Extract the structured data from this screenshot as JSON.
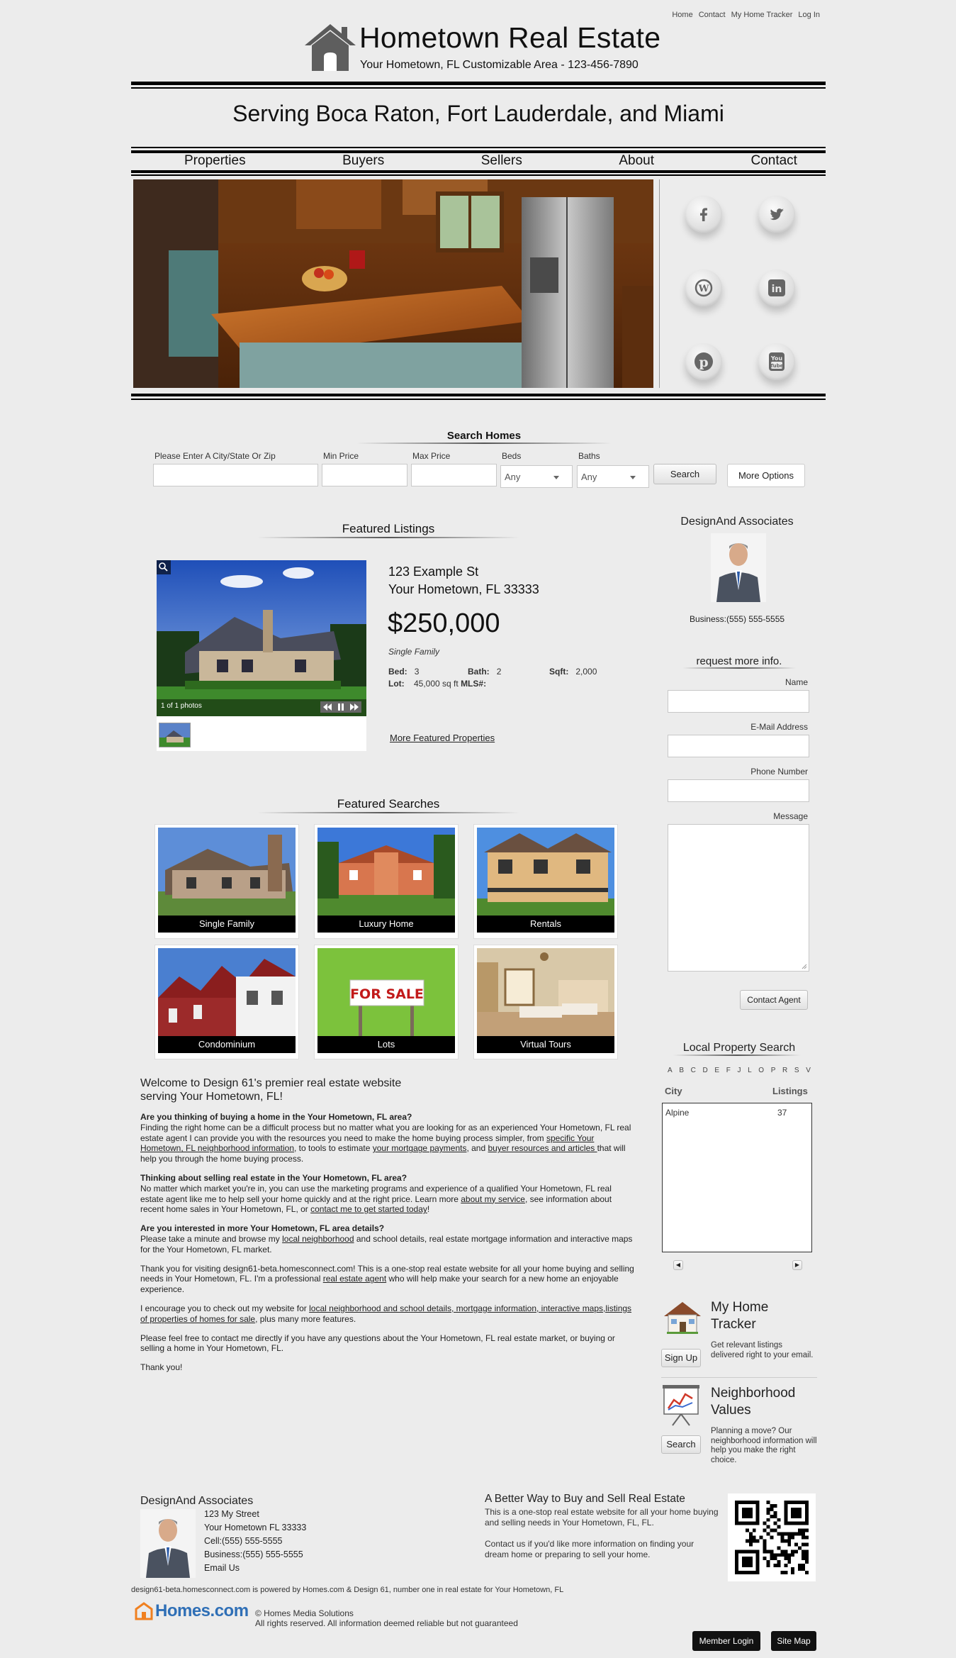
{
  "top_links": [
    "Home",
    "Contact",
    "My Home Tracker",
    "Log In"
  ],
  "header": {
    "title": "Hometown Real Estate",
    "subtitle": "Your Hometown, FL Customizable Area - 123-456-7890",
    "tagline": "Serving Boca Raton, Fort Lauderdale, and Miami"
  },
  "nav": [
    "Properties",
    "Buyers",
    "Sellers",
    "About",
    "Contact"
  ],
  "social_icons": [
    "facebook-icon",
    "twitter-icon",
    "wordpress-icon",
    "linkedin-icon",
    "pinterest-icon",
    "youtube-icon"
  ],
  "search": {
    "title": "Search Homes",
    "city_label": "Please Enter A City/State Or Zip",
    "min_label": "Min Price",
    "max_label": "Max Price",
    "beds_label": "Beds",
    "baths_label": "Baths",
    "beds_value": "Any",
    "baths_value": "Any",
    "search_button": "Search",
    "more_button": "More Options"
  },
  "featured": {
    "title": "Featured Listings",
    "address_line1": "123 Example St",
    "address_line2": "Your Hometown, FL 33333",
    "price": "$250,000",
    "type": "Single Family",
    "bed_label": "Bed:",
    "bed": "3",
    "bath_label": "Bath:",
    "bath": "2",
    "sqft_label": "Sqft:",
    "sqft": "2,000",
    "lot_label": "Lot:",
    "lot": "45,000 sq ft",
    "mls_label": "MLS#:",
    "photo_count": "1 of 1 photos",
    "more_link": "More Featured Properties"
  },
  "featured_searches": {
    "title": "Featured Searches",
    "tiles": [
      "Single Family",
      "Luxury Home",
      "Rentals",
      "Condominium",
      "Lots",
      "Virtual Tours"
    ],
    "sign_text": "FOR SALE"
  },
  "welcome": {
    "heading_line1": "Welcome to Design 61's premier real estate website",
    "heading_line2": "serving Your Hometown, FL!",
    "q1": "Are you thinking of buying a home in the Your Hometown, FL area?",
    "p1a": "Finding the right home can be a difficult process but no matter what you are looking for as an experienced Your Hometown, FL real estate agent I can provide you with the resources you need to make the home buying process simpler, from ",
    "p1_link1": "specific Your Hometown, FL neighborhood information",
    "p1b": ", to tools to estimate ",
    "p1_link2": "your mortgage payments",
    "p1c": ", and ",
    "p1_link3": "buyer resources and articles ",
    "p1d": "that will help you through the home buying process.",
    "q2": "Thinking about selling real estate in the Your Hometown, FL area?",
    "p2a": "No matter which market you're in, you can use the marketing programs and experience of a qualified Your Hometown, FL real estate agent like me to help sell your home quickly and at the right price. Learn more ",
    "p2_link1": "about my service",
    "p2b": ", see information about recent home sales in Your Hometown, FL, or ",
    "p2_link2": "contact me to get started today",
    "p2c": "!",
    "q3": "Are you interested in more Your Hometown, FL area details?",
    "p3a": "Please take a minute and browse my ",
    "p3_link": "local neighborhood",
    "p3b": " and school details, real estate mortgage information and interactive maps for the Your Hometown, FL market.",
    "p4a": "Thank you for visiting design61-beta.homesconnect.com! This is a one-stop real estate website for all your home buying and selling needs in Your Hometown, FL. I'm a professional ",
    "p4_link": "real estate agent",
    "p4b": " who will help make your search for a new home an enjoyable experience.",
    "p5a": "I encourage you to check out my website for ",
    "p5_link": "local neighborhood and school details, mortgage information, interactive maps,listings of properties of homes for sale",
    "p5b": ", plus many more features.",
    "p6": "Please feel free to contact me directly if you have any questions about the Your Hometown, FL real estate market, or buying or selling a home in Your Hometown, FL.",
    "p7": "Thank you!"
  },
  "agent": {
    "name": "DesignAnd Associates",
    "business_phone": "Business:(555) 555-5555"
  },
  "contact_form": {
    "title": "request more info.",
    "name_label": "Name",
    "email_label": "E-Mail Address",
    "phone_label": "Phone Number",
    "message_label": "Message",
    "submit": "Contact Agent"
  },
  "local_search": {
    "title": "Local Property Search",
    "letters": [
      "A",
      "B",
      "C",
      "D",
      "E",
      "F",
      "J",
      "L",
      "O",
      "P",
      "R",
      "S",
      "V"
    ],
    "col_city": "City",
    "col_listings": "Listings",
    "rows": [
      {
        "city": "Alpine",
        "listings": "37"
      }
    ]
  },
  "tracker": {
    "title_line1": "My Home",
    "title_line2": "Tracker",
    "button": "Sign Up",
    "desc": "Get relevant listings delivered right to your email."
  },
  "neighborhood": {
    "title_line1": "Neighborhood",
    "title_line2": "Values",
    "button": "Search",
    "desc": "Planning a move? Our neighborhood information will help you make the right choice."
  },
  "footer": {
    "agent_name": "DesignAnd Associates",
    "street": "123 My Street",
    "city": "Your Hometown FL  33333",
    "cell": "Cell:(555) 555-5555",
    "business": "Business:(555) 555-5555",
    "email_link": "Email Us",
    "better_title": "A Better Way to Buy and Sell Real Estate",
    "better_text": "This is a one-stop real estate website for all your home buying and selling needs in Your Hometown, FL, FL.",
    "better_text2": "Contact us if you'd like more information on finding your dream home or preparing to sell your home.",
    "powered": "design61-beta.homesconnect.com is powered by Homes.com & Design 61, number one in real estate for Your Hometown, FL",
    "homes_logo": "Homes.com",
    "copyright": "© Homes Media Solutions",
    "rights": "All rights reserved. All information deemed reliable but not guaranteed",
    "member_login": "Member Login",
    "site_map": "Site Map"
  }
}
